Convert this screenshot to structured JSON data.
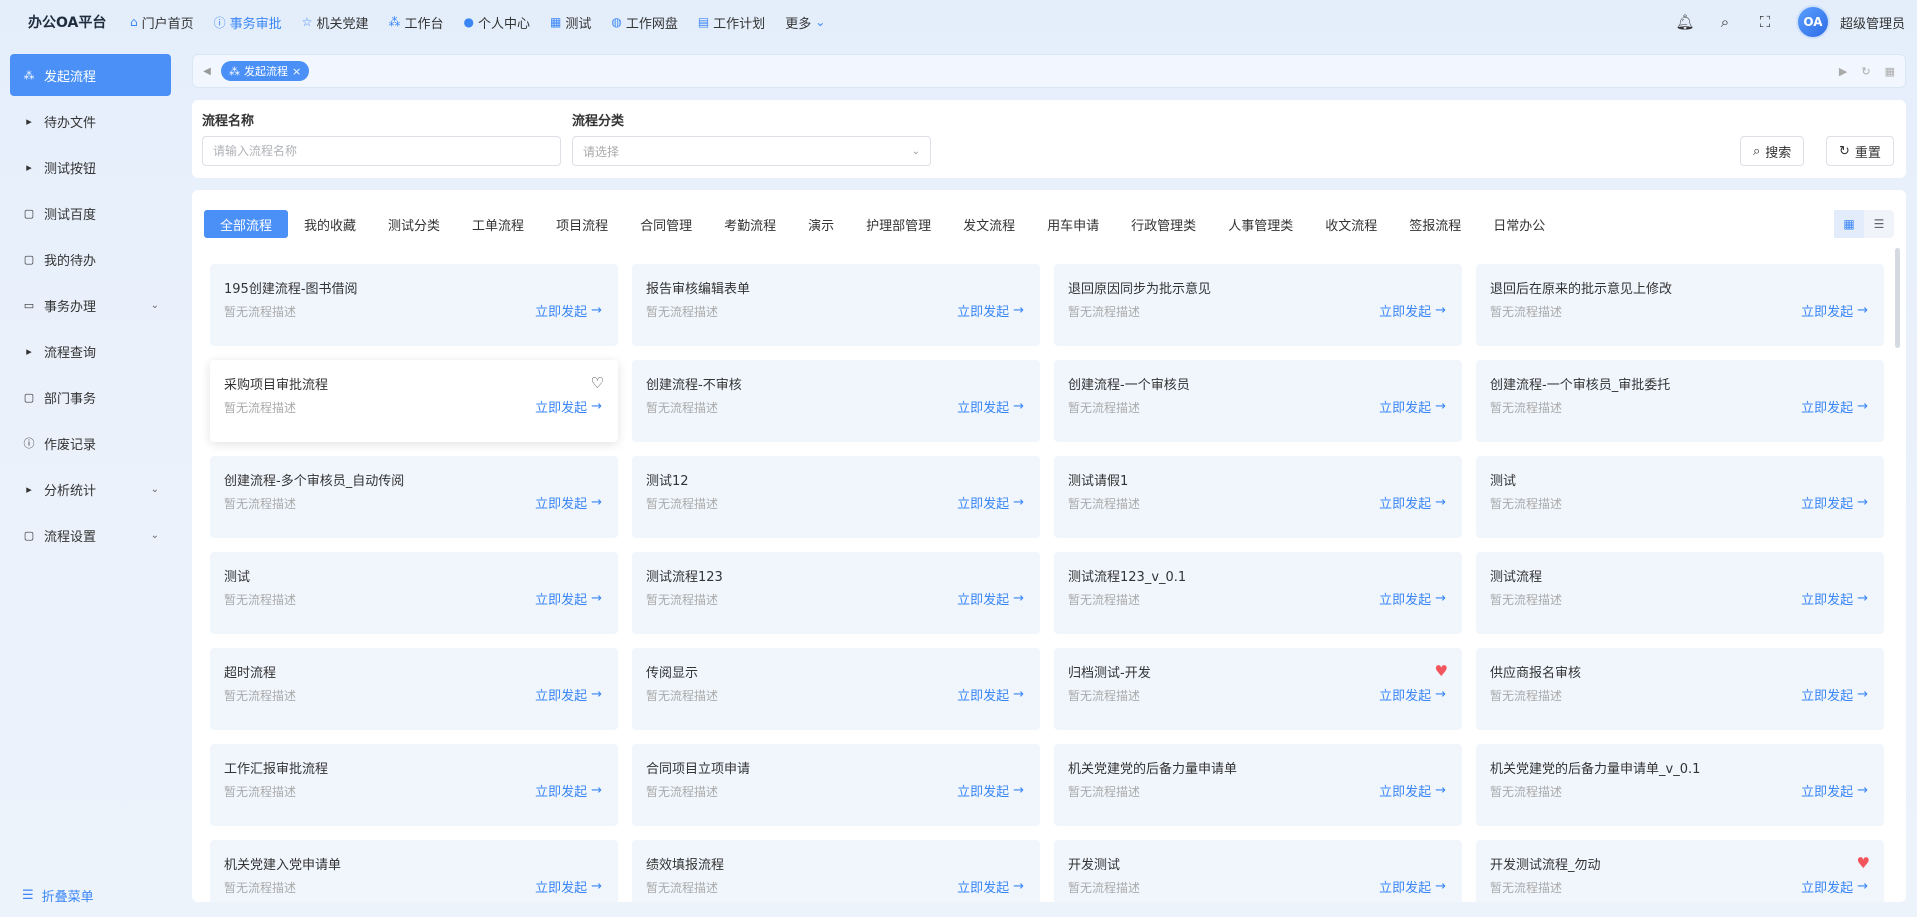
{
  "brand": "办公OA平台",
  "nav": [
    {
      "label": "门户首页",
      "icon": "home-icon",
      "glyph": "⌂"
    },
    {
      "label": "事务审批",
      "icon": "info-icon",
      "glyph": "ⓘ",
      "active": true
    },
    {
      "label": "机关党建",
      "icon": "star-icon",
      "glyph": "☆"
    },
    {
      "label": "工作台",
      "icon": "org-chart-icon",
      "glyph": "⁂"
    },
    {
      "label": "个人中心",
      "icon": "user-icon",
      "glyph": "●"
    },
    {
      "label": "测试",
      "icon": "calendar-icon",
      "glyph": "▦"
    },
    {
      "label": "工作网盘",
      "icon": "database-icon",
      "glyph": "◍"
    },
    {
      "label": "工作计划",
      "icon": "schedule-icon",
      "glyph": "▤"
    },
    {
      "label": "更多",
      "icon": "chevron-down-icon",
      "glyph": "⌄"
    }
  ],
  "user": {
    "avatar_text": "OA",
    "name": "超级管理员"
  },
  "sidebar": {
    "items": [
      {
        "label": "发起流程",
        "icon": "sitemap-icon",
        "glyph": "⁂",
        "active": true
      },
      {
        "label": "待办文件",
        "icon": "caret-right-icon",
        "glyph": "▸"
      },
      {
        "label": "测试按钮",
        "icon": "caret-right-icon",
        "glyph": "▸"
      },
      {
        "label": "测试百度",
        "icon": "document-icon",
        "glyph": "▢"
      },
      {
        "label": "我的待办",
        "icon": "document-icon",
        "glyph": "▢"
      },
      {
        "label": "事务办理",
        "icon": "folder-icon",
        "glyph": "▭",
        "chevron": true
      },
      {
        "label": "流程查询",
        "icon": "caret-right-icon",
        "glyph": "▸"
      },
      {
        "label": "部门事务",
        "icon": "document-icon",
        "glyph": "▢"
      },
      {
        "label": "作废记录",
        "icon": "info-icon",
        "glyph": "ⓘ"
      },
      {
        "label": "分析统计",
        "icon": "caret-right-icon",
        "glyph": "▸",
        "chevron": true
      },
      {
        "label": "流程设置",
        "icon": "document-icon",
        "glyph": "▢",
        "chevron": true
      }
    ],
    "collapse_label": "折叠菜单"
  },
  "tabstrip": {
    "active_tab": "发起流程"
  },
  "filter": {
    "name_label": "流程名称",
    "name_placeholder": "请输入流程名称",
    "category_label": "流程分类",
    "category_placeholder": "请选择",
    "search_label": "搜索",
    "reset_label": "重置"
  },
  "categories": [
    "全部流程",
    "我的收藏",
    "测试分类",
    "工单流程",
    "项目流程",
    "合同管理",
    "考勤流程",
    "演示",
    "护理部管理",
    "发文流程",
    "用车申请",
    "行政管理类",
    "人事管理类",
    "收文流程",
    "签报流程",
    "日常办公"
  ],
  "card_common": {
    "desc": "暂无流程描述",
    "start": "立即发起"
  },
  "cards": [
    {
      "title": "195创建流程-图书借阅"
    },
    {
      "title": "报告审核编辑表单"
    },
    {
      "title": "退回原因同步为批示意见"
    },
    {
      "title": "退回后在原来的批示意见上修改"
    },
    {
      "title": "采购项目审批流程",
      "heart": "empty"
    },
    {
      "title": "创建流程-不审核"
    },
    {
      "title": "创建流程-一个审核员"
    },
    {
      "title": "创建流程-一个审核员_审批委托"
    },
    {
      "title": "创建流程-多个审核员_自动传阅"
    },
    {
      "title": "测试12"
    },
    {
      "title": "测试请假1"
    },
    {
      "title": "测试"
    },
    {
      "title": "测试"
    },
    {
      "title": "测试流程123"
    },
    {
      "title": "测试流程123_v_0.1"
    },
    {
      "title": "测试流程"
    },
    {
      "title": "超时流程"
    },
    {
      "title": "传阅显示"
    },
    {
      "title": "归档测试-开发",
      "heart": "full"
    },
    {
      "title": "供应商报名审核"
    },
    {
      "title": "工作汇报审批流程"
    },
    {
      "title": "合同项目立项申请"
    },
    {
      "title": "机关党建党的后备力量申请单"
    },
    {
      "title": "机关党建党的后备力量申请单_v_0.1"
    },
    {
      "title": "机关党建入党申请单"
    },
    {
      "title": "绩效填报流程"
    },
    {
      "title": "开发测试"
    },
    {
      "title": "开发测试流程_勿动",
      "heart": "full"
    }
  ]
}
